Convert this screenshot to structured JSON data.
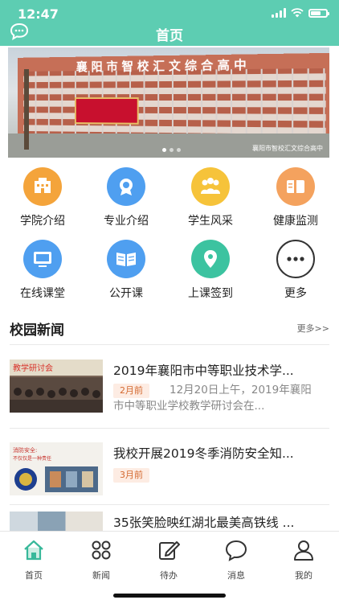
{
  "status_bar": {
    "time": "12:47"
  },
  "header": {
    "title": "首页"
  },
  "banner": {
    "caption": "襄阳市智校汇文综合高中",
    "roof_text": "襄阳市智校汇文综合高中"
  },
  "menu": [
    {
      "label": "学院介绍",
      "icon": "building-icon",
      "color": "#f4a43b"
    },
    {
      "label": "专业介绍",
      "icon": "medal-icon",
      "color": "#4f9ff0"
    },
    {
      "label": "学生风采",
      "icon": "people-icon",
      "color": "#f6c33a"
    },
    {
      "label": "健康监测",
      "icon": "book-icon",
      "color": "#f4a25e"
    },
    {
      "label": "在线课堂",
      "icon": "monitor-icon",
      "color": "#4f9ff0"
    },
    {
      "label": "公开课",
      "icon": "open-book-icon",
      "color": "#4f9ff0"
    },
    {
      "label": "上课签到",
      "icon": "location-pin-icon",
      "color": "#3cc3a0"
    },
    {
      "label": "更多",
      "icon": "more-icon",
      "color": "#ffffff"
    }
  ],
  "news_section": {
    "title": "校园新闻",
    "more": "更多>>"
  },
  "news": [
    {
      "title": "2019年襄阳市中等职业技术学...",
      "tag": "2月前",
      "summary": "12月20日上午，2019年襄阳市中等职业学校教学研讨会在..."
    },
    {
      "title": "我校开展2019冬季消防安全知...",
      "tag": "3月前",
      "summary": ""
    },
    {
      "title": "35张笑脸映红湖北最美高铁线 ...",
      "tag": "",
      "summary": ""
    }
  ],
  "tabbar": [
    {
      "label": "首页",
      "icon": "home-icon"
    },
    {
      "label": "新闻",
      "icon": "grid-icon"
    },
    {
      "label": "待办",
      "icon": "edit-icon"
    },
    {
      "label": "消息",
      "icon": "chat-bubble-icon"
    },
    {
      "label": "我的",
      "icon": "person-icon"
    }
  ],
  "colors": {
    "accent": "#5dcdb2",
    "tag_text": "#d3682f",
    "tag_bg": "#fdece3"
  }
}
